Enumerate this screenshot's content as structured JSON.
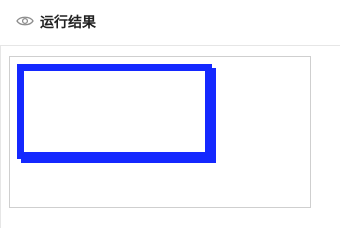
{
  "header": {
    "icon": "eye-icon",
    "title": "运行结果"
  },
  "result": {
    "shape": "rectangle-outline",
    "stroke_color": "#1428ff"
  },
  "colors": {
    "frame_border": "#cfcfcf",
    "divider": "#e6e6e6",
    "title_text": "#222222",
    "icon": "#8c8c8c"
  }
}
